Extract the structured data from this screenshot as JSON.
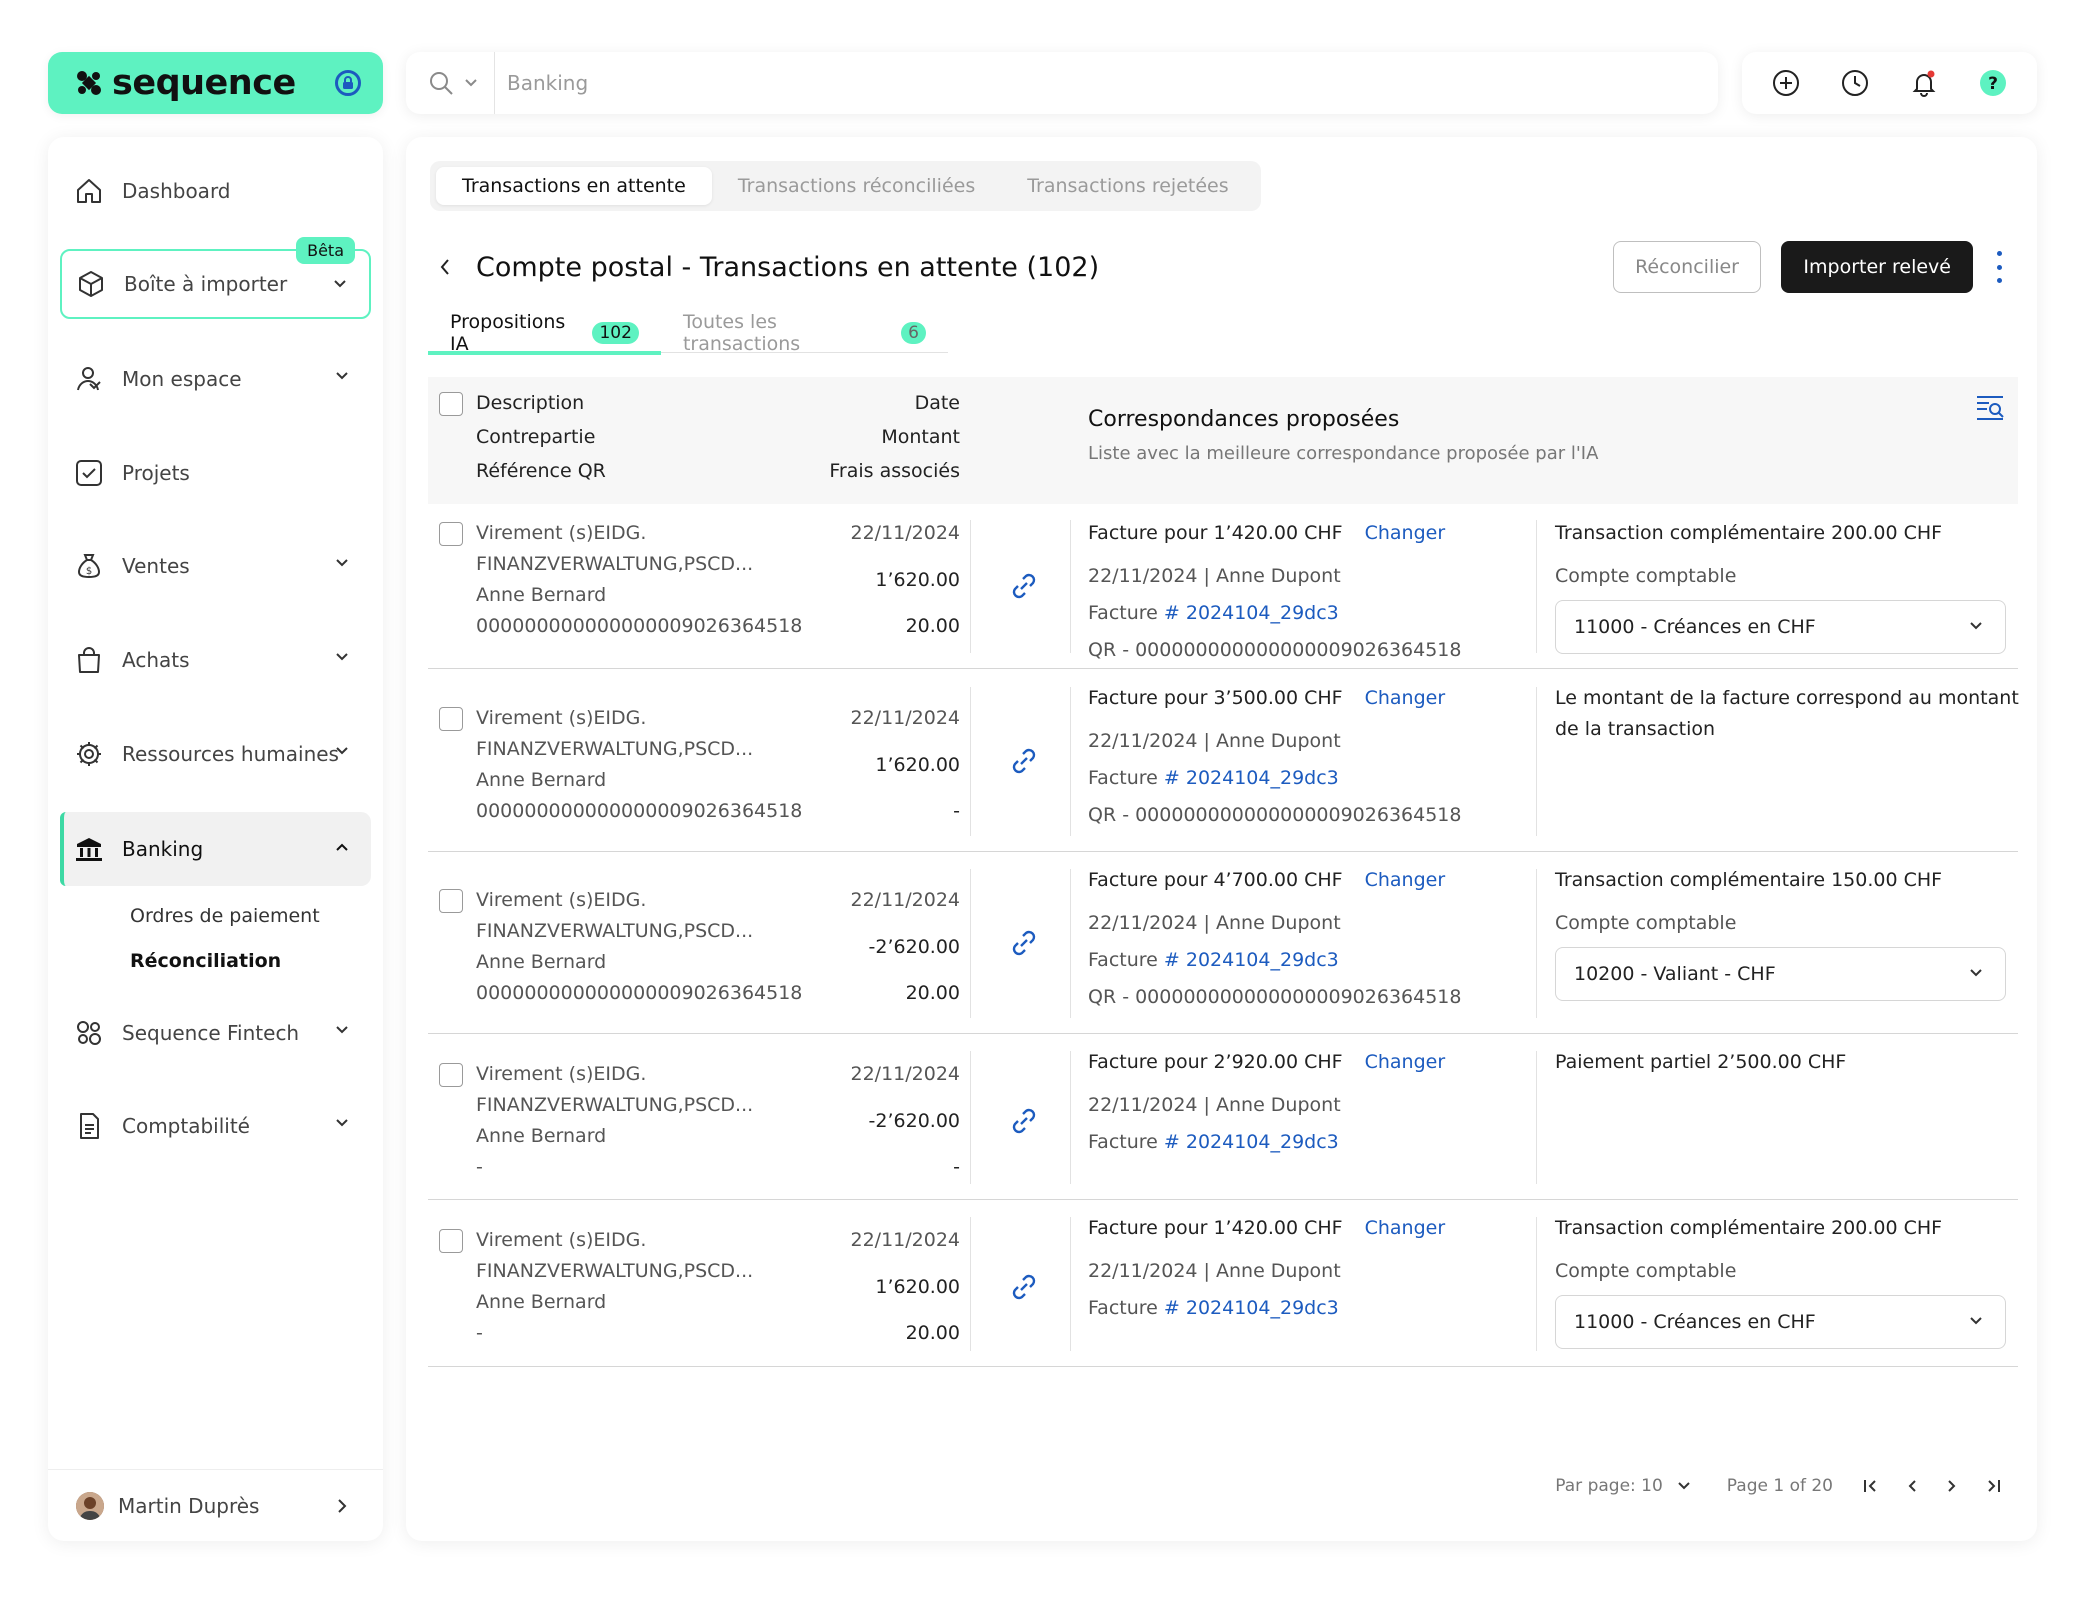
{
  "brand": {
    "name": "sequence",
    "accent": "#5ef2c1",
    "link_color": "#1c5bbf"
  },
  "search": {
    "placeholder": "Banking",
    "icon": "search-icon"
  },
  "top_actions": [
    {
      "name": "add-icon"
    },
    {
      "name": "history-icon"
    },
    {
      "name": "bell-icon"
    },
    {
      "name": "help-icon"
    }
  ],
  "sidebar": {
    "items": [
      {
        "label": "Dashboard",
        "icon": "home-icon"
      },
      {
        "label": "Boîte à importer",
        "icon": "box-icon",
        "badge": "Bêta"
      },
      {
        "label": "Mon espace",
        "icon": "user-icon"
      },
      {
        "label": "Projets",
        "icon": "checkbox-icon"
      },
      {
        "label": "Ventes",
        "icon": "money-bag-icon"
      },
      {
        "label": "Achats",
        "icon": "shopping-bag-icon"
      },
      {
        "label": "Ressources humaines",
        "icon": "gear-icon"
      },
      {
        "label": "Banking",
        "icon": "bank-icon"
      },
      {
        "label": "Sequence Fintech",
        "icon": "fintech-icon"
      },
      {
        "label": "Comptabilité",
        "icon": "ledger-icon"
      }
    ],
    "banking_sub": [
      "Ordres de paiement",
      "Réconciliation"
    ],
    "user": "Martin Duprès"
  },
  "main": {
    "tabs": [
      "Transactions en attente",
      "Transactions réconciliées",
      "Transactions rejetées"
    ],
    "title": "Compte postal - Transactions en attente (102)",
    "reconcile_label": "Réconcilier",
    "import_label": "Importer relevé",
    "subtabs": [
      {
        "label": "Propositions IA",
        "count": "102"
      },
      {
        "label": "Toutes les transactions",
        "count": "6"
      }
    ],
    "table_head": {
      "description": "Description",
      "counterparty": "Contrepartie",
      "qr_ref": "Référence QR",
      "date": "Date",
      "amount": "Montant",
      "fees": "Frais associés",
      "match_title": "Correspondances proposées",
      "match_sub": "Liste avec la meilleure correspondance proposée par l'IA"
    },
    "change_label": "Changer",
    "rows": [
      {
        "desc1": "Virement (s)EIDG.",
        "desc2": "FINANZVERWALTUNG,PSCD...",
        "party": "Anne Bernard",
        "qr": "000000000000000009026364518",
        "date": "22/11/2024",
        "amount": "1’620.00",
        "fees": "20.00",
        "invoice": "Facture pour 1’420.00 CHF",
        "meta": "22/11/2024 | Anne Dupont",
        "inv_prefix": "Facture",
        "inv_ref": "# 2024104_29dc3",
        "qr_line": "QR - 000000000000000009026364518",
        "right_title": "Transaction complémentaire 200.00 CHF",
        "right_label": "Compte comptable",
        "account": "11000 - Créances en CHF"
      },
      {
        "desc1": "Virement (s)EIDG.",
        "desc2": "FINANZVERWALTUNG,PSCD...",
        "party": "Anne Bernard",
        "qr": "000000000000000009026364518",
        "date": "22/11/2024",
        "amount": "1’620.00",
        "fees": "-",
        "invoice": "Facture pour 3’500.00 CHF",
        "meta": "22/11/2024 | Anne Dupont",
        "inv_prefix": "Facture",
        "inv_ref": "# 2024104_29dc3",
        "qr_line": "QR - 000000000000000009026364518",
        "right_title": "Le montant de la facture correspond au montant",
        "right_title2": "de la transaction"
      },
      {
        "desc1": "Virement (s)EIDG.",
        "desc2": "FINANZVERWALTUNG,PSCD...",
        "party": "Anne Bernard",
        "qr": "000000000000000009026364518",
        "date": "22/11/2024",
        "amount": "-2’620.00",
        "fees": "20.00",
        "invoice": "Facture pour 4’700.00 CHF",
        "meta": "22/11/2024 | Anne Dupont",
        "inv_prefix": "Facture",
        "inv_ref": "# 2024104_29dc3",
        "qr_line": "QR - 000000000000000009026364518",
        "right_title": "Transaction complémentaire 150.00 CHF",
        "right_label": "Compte comptable",
        "account": "10200 - Valiant - CHF"
      },
      {
        "desc1": "Virement (s)EIDG.",
        "desc2": "FINANZVERWALTUNG,PSCD...",
        "party": "Anne Bernard",
        "qr": "-",
        "date": "22/11/2024",
        "amount": "-2’620.00",
        "fees": "-",
        "invoice": "Facture pour 2’920.00 CHF",
        "meta": "22/11/2024 | Anne Dupont",
        "inv_prefix": "Facture",
        "inv_ref": "# 2024104_29dc3",
        "right_title": "Paiement partiel 2’500.00 CHF"
      },
      {
        "desc1": "Virement (s)EIDG.",
        "desc2": "FINANZVERWALTUNG,PSCD...",
        "party": "Anne Bernard",
        "qr": "-",
        "date": "22/11/2024",
        "amount": "1’620.00",
        "fees": "20.00",
        "invoice": "Facture pour 1’420.00 CHF",
        "meta": "22/11/2024 | Anne Dupont",
        "inv_prefix": "Facture",
        "inv_ref": "# 2024104_29dc3",
        "right_title": "Transaction complémentaire 200.00 CHF",
        "right_label": "Compte comptable",
        "account": "11000 - Créances en CHF"
      }
    ],
    "pagination": {
      "per_page": "Par page: 10",
      "page": "Page 1 of 20"
    }
  }
}
